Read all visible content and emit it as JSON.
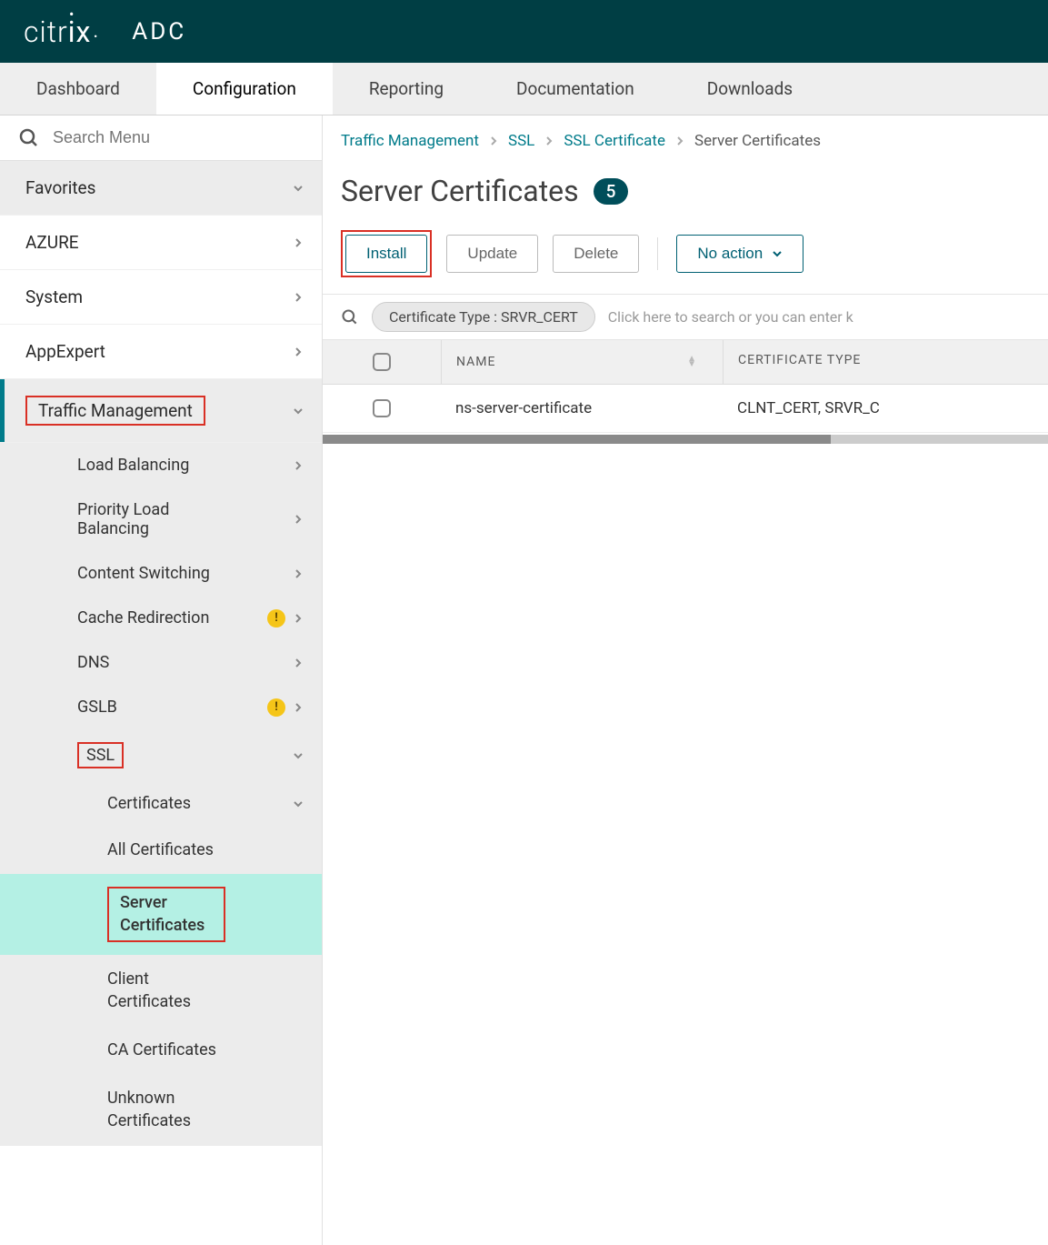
{
  "header": {
    "logo_text": "citrix",
    "subtitle": "ADC"
  },
  "tabs": {
    "items": [
      "Dashboard",
      "Configuration",
      "Reporting",
      "Documentation",
      "Downloads"
    ],
    "active": 1
  },
  "sidebar": {
    "search_placeholder": "Search Menu",
    "favorites_label": "Favorites",
    "top_items": [
      {
        "label": "AZURE"
      },
      {
        "label": "System"
      },
      {
        "label": "AppExpert"
      }
    ],
    "traffic_mgmt": {
      "label": "Traffic Management",
      "children": [
        {
          "label": "Load Balancing",
          "warn": false
        },
        {
          "label": "Priority Load Balancing",
          "warn": false
        },
        {
          "label": "Content Switching",
          "warn": false
        },
        {
          "label": "Cache Redirection",
          "warn": true
        },
        {
          "label": "DNS",
          "warn": false
        },
        {
          "label": "GSLB",
          "warn": true
        }
      ],
      "ssl": {
        "label": "SSL",
        "certificates_label": "Certificates",
        "cert_items": [
          {
            "label": "All Certificates",
            "selected": false
          },
          {
            "label": "Server Certificates",
            "selected": true
          },
          {
            "label": "Client Certificates",
            "selected": false
          },
          {
            "label": "CA Certificates",
            "selected": false
          },
          {
            "label": "Unknown Certificates",
            "selected": false
          }
        ]
      }
    }
  },
  "breadcrumb": {
    "items": [
      "Traffic Management",
      "SSL",
      "SSL Certificate",
      "Server Certificates"
    ]
  },
  "page": {
    "title": "Server Certificates",
    "count": "5"
  },
  "actions": {
    "install": "Install",
    "update": "Update",
    "delete": "Delete",
    "noaction": "No action"
  },
  "filter": {
    "chip": "Certificate Type : SRVR_CERT",
    "hint": "Click here to search or you can enter k"
  },
  "table": {
    "columns": {
      "name": "NAME",
      "type": "CERTIFICATE TYPE"
    },
    "rows": [
      {
        "name": "ns-server-certificate",
        "type": "CLNT_CERT, SRVR_C"
      }
    ]
  }
}
